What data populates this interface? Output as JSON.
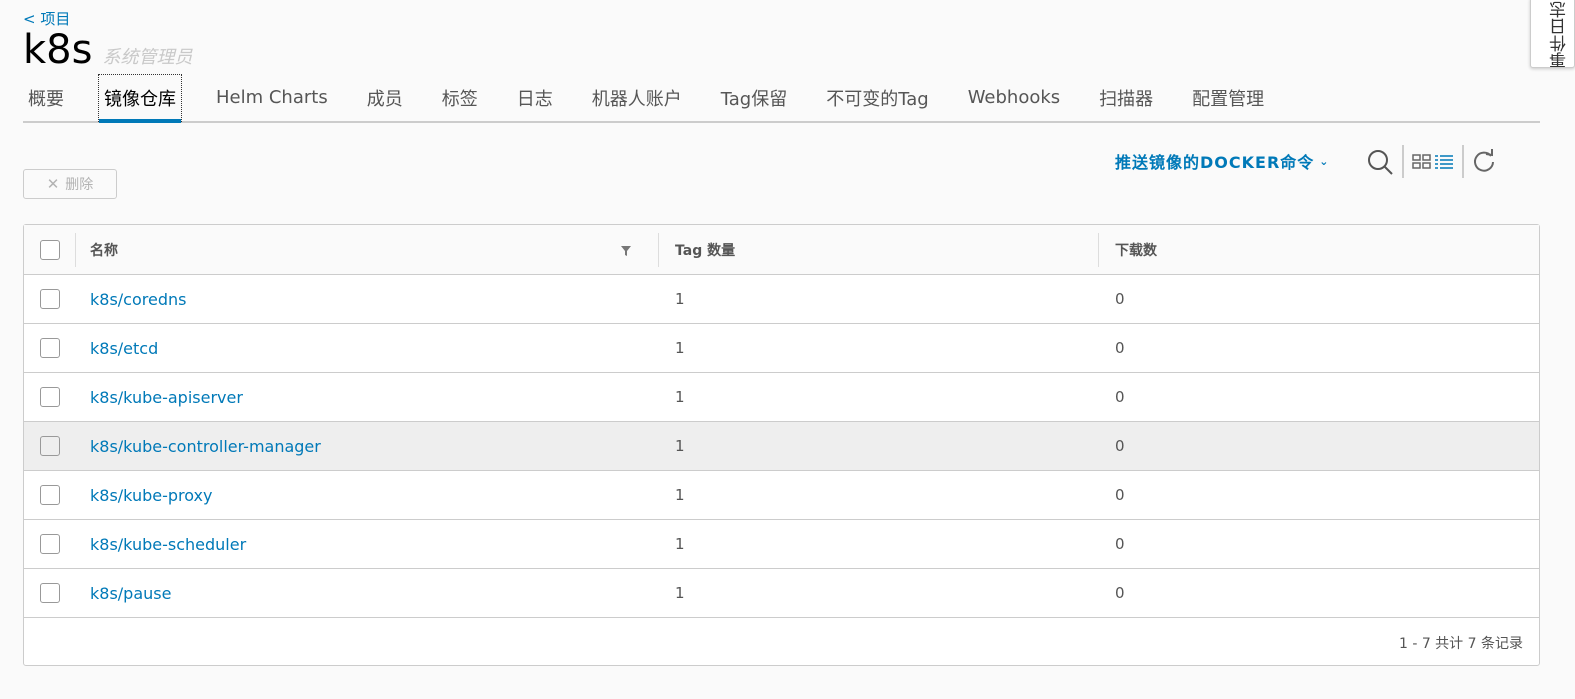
{
  "header": {
    "back_label": "< 项目",
    "project_name": "k8s",
    "role": "系统管理员"
  },
  "side_panel": {
    "label": "事件日志"
  },
  "tabs": [
    {
      "label": "概要",
      "active": false
    },
    {
      "label": "镜像仓库",
      "active": true
    },
    {
      "label": "Helm Charts",
      "active": false
    },
    {
      "label": "成员",
      "active": false
    },
    {
      "label": "标签",
      "active": false
    },
    {
      "label": "日志",
      "active": false
    },
    {
      "label": "机器人账户",
      "active": false
    },
    {
      "label": "Tag保留",
      "active": false
    },
    {
      "label": "不可变的Tag",
      "active": false
    },
    {
      "label": "Webhooks",
      "active": false
    },
    {
      "label": "扫描器",
      "active": false
    },
    {
      "label": "配置管理",
      "active": false
    }
  ],
  "toolbar": {
    "delete_label": "删除",
    "push_command_label": "推送镜像的DOCKER命令"
  },
  "table": {
    "columns": [
      "名称",
      "Tag 数量",
      "下载数"
    ],
    "rows": [
      {
        "name": "k8s/coredns",
        "tags": "1",
        "pulls": "0"
      },
      {
        "name": "k8s/etcd",
        "tags": "1",
        "pulls": "0"
      },
      {
        "name": "k8s/kube-apiserver",
        "tags": "1",
        "pulls": "0"
      },
      {
        "name": "k8s/kube-controller-manager",
        "tags": "1",
        "pulls": "0"
      },
      {
        "name": "k8s/kube-proxy",
        "tags": "1",
        "pulls": "0"
      },
      {
        "name": "k8s/kube-scheduler",
        "tags": "1",
        "pulls": "0"
      },
      {
        "name": "k8s/pause",
        "tags": "1",
        "pulls": "0"
      }
    ],
    "footer": "1 - 7 共计 7 条记录"
  },
  "colors": {
    "accent": "#0079b8",
    "border": "#cccccc",
    "hover_row": "#eeeeee"
  }
}
